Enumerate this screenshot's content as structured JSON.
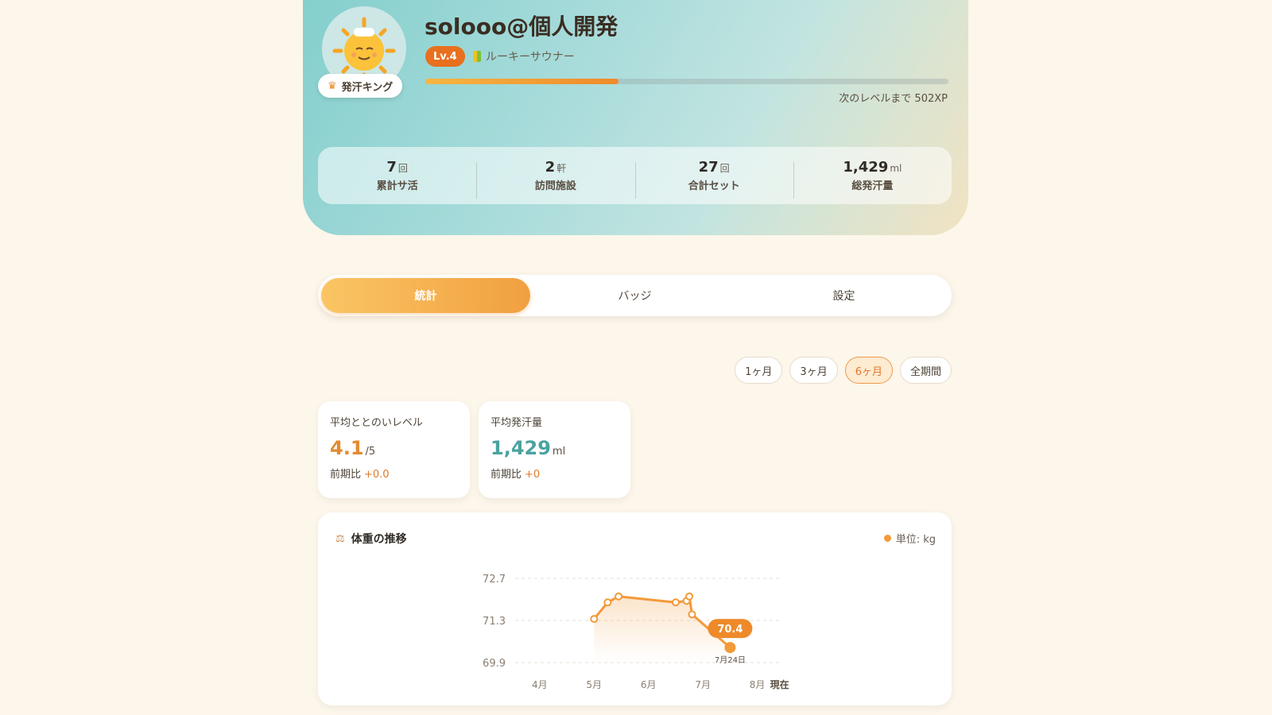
{
  "profile": {
    "username": "solooo@個人開発",
    "title_badge": "発汗キング",
    "level": "Lv.4",
    "rank": "ルーキーサウナー",
    "xp_progress": 0.37,
    "xp_next_label": "次のレベルまで 502XP"
  },
  "stats": [
    {
      "value": "7",
      "unit": "回",
      "label": "累計サ活"
    },
    {
      "value": "2",
      "unit": "軒",
      "label": "訪問施設"
    },
    {
      "value": "27",
      "unit": "回",
      "label": "合計セット"
    },
    {
      "value": "1,429",
      "unit": "ml",
      "label": "総発汗量"
    }
  ],
  "tabs": [
    {
      "label": "統計",
      "active": true
    },
    {
      "label": "バッジ",
      "active": false
    },
    {
      "label": "設定",
      "active": false
    }
  ],
  "periods": [
    {
      "label": "1ヶ月",
      "active": false
    },
    {
      "label": "3ヶ月",
      "active": false
    },
    {
      "label": "6ヶ月",
      "active": true
    },
    {
      "label": "全期間",
      "active": false
    }
  ],
  "kpis": [
    {
      "title": "平均ととのいレベル",
      "value": "4.1",
      "unit": "/5",
      "delta_label": "前期比",
      "delta": "+0.0",
      "color": "#e58a2e"
    },
    {
      "title": "平均発汗量",
      "value": "1,429",
      "unit": "ml",
      "delta_label": "前期比",
      "delta": "+0",
      "color": "#4aa3a0"
    }
  ],
  "chart": {
    "title": "体重の推移",
    "unit_label": "単位: kg",
    "latest_label": "70.4",
    "latest_date": "7月24日",
    "now_label": "現在"
  },
  "chart_data": {
    "type": "area",
    "ylabels": [
      "72.7",
      "71.3",
      "69.9"
    ],
    "ylim": [
      69.9,
      72.7
    ],
    "xlabels": [
      "4月",
      "5月",
      "6月",
      "7月",
      "8月"
    ],
    "xlim": [
      3.55,
      8.4
    ],
    "series": [
      {
        "x": [
          5.0,
          5.25,
          5.45,
          6.5,
          6.7,
          6.75,
          6.8,
          7.5
        ],
        "y": [
          71.35,
          71.9,
          72.1,
          71.9,
          71.95,
          72.1,
          71.5,
          70.4
        ]
      }
    ],
    "grid": true,
    "color": "#f39a3a"
  }
}
